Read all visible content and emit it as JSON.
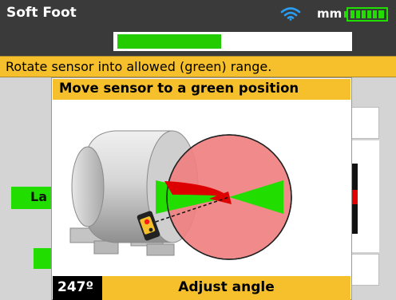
{
  "header": {
    "title": "Soft Foot",
    "unit": "mm",
    "wifi_icon": "wifi-icon",
    "battery_icon": "battery-icon",
    "measurement_progress": 0.45
  },
  "instruction": {
    "text": "Rotate sensor into allowed (green) range."
  },
  "background": {
    "tag_label": "La"
  },
  "popup": {
    "title": "Move sensor to a green position",
    "angle": "247º",
    "action_label": "Adjust angle"
  },
  "colors": {
    "accent_yellow": "#f5c02c",
    "allowed_green": "#22dd00",
    "forbidden_red": "#f08080",
    "title_bar": "#3a3a3a"
  }
}
